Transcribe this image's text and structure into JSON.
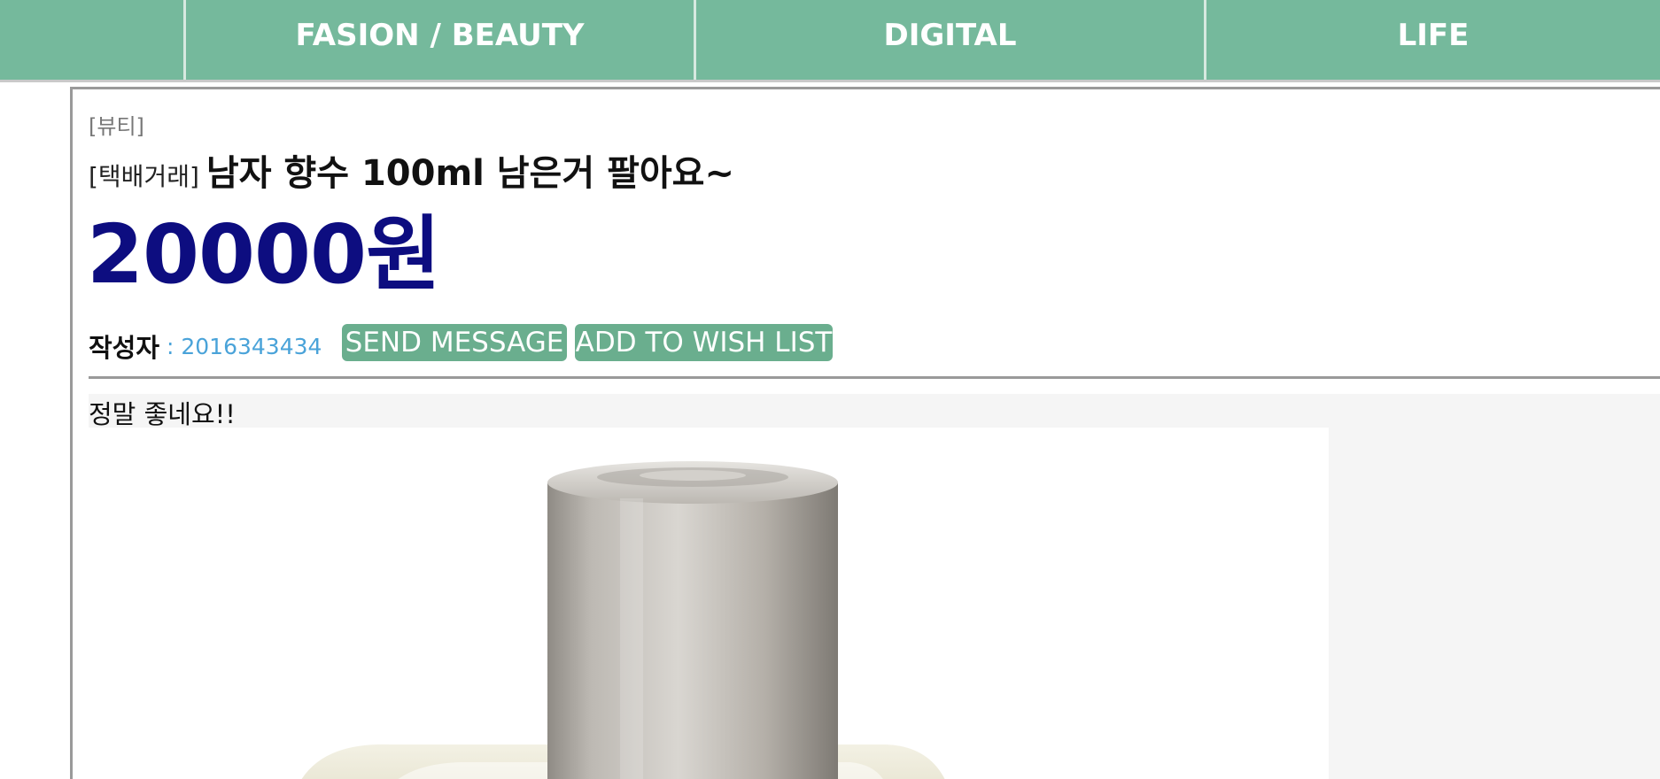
{
  "nav": {
    "items": [
      {
        "label": "FASION / BEAUTY"
      },
      {
        "label": "DIGITAL"
      },
      {
        "label": "LIFE"
      }
    ]
  },
  "post": {
    "category": "[뷰티]",
    "trade_type": "[택배거래]",
    "title": "남자 향수 100ml 남은거 팔아요~",
    "price": "20000원",
    "author_label": "작성자",
    "author_id": ": 2016343434",
    "send_message_label": "SEND MESSAGE",
    "wishlist_label": "ADD TO WISH LIST",
    "description": "정말 좋네요!!",
    "image_icon": "perfume-bottle-image"
  },
  "colors": {
    "nav_bg": "#75b99c",
    "button_bg": "#6aae8e",
    "price": "#0d0d80",
    "author_id": "#4aa3d9"
  }
}
